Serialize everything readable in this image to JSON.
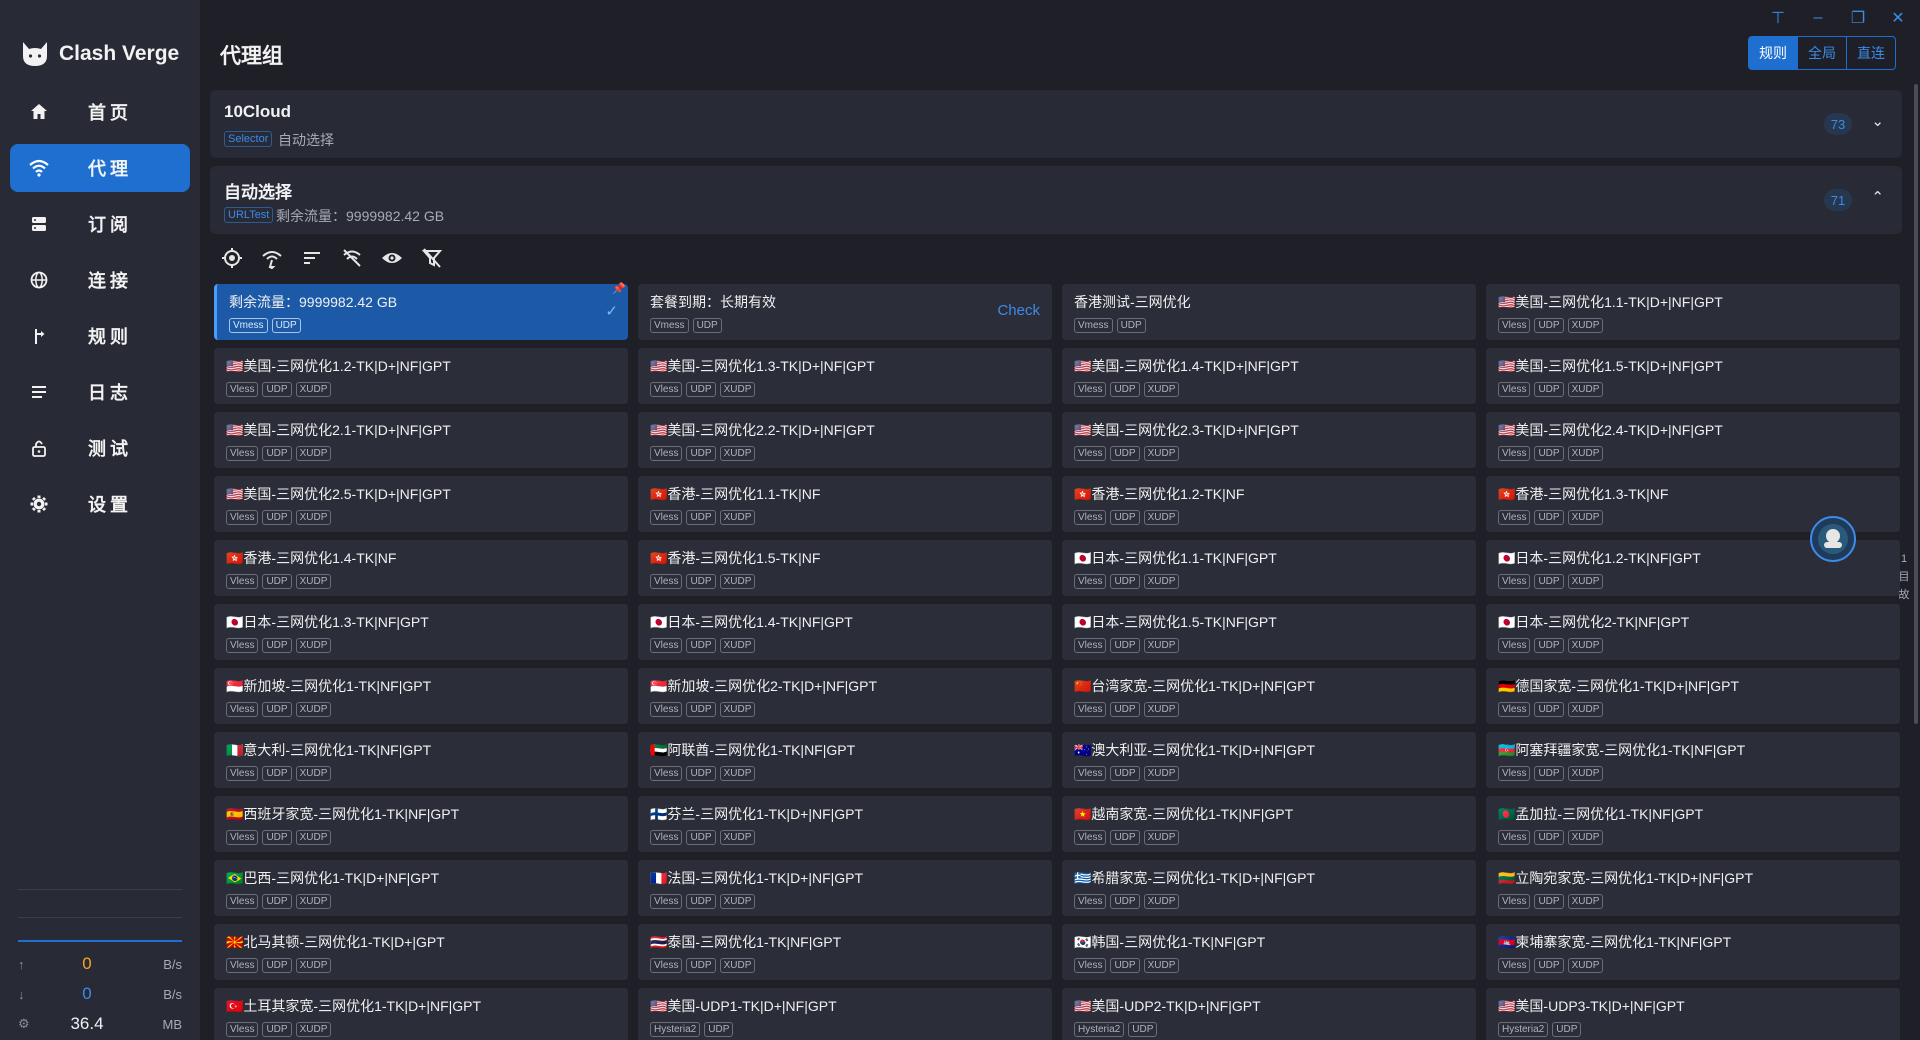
{
  "app": {
    "name": "Clash Verge"
  },
  "sidebar": {
    "items": [
      {
        "label": "首页",
        "icon": "home-icon",
        "active": false
      },
      {
        "label": "代理",
        "icon": "wifi-icon",
        "active": true
      },
      {
        "label": "订阅",
        "icon": "server-icon",
        "active": false
      },
      {
        "label": "连接",
        "icon": "globe-icon",
        "active": false
      },
      {
        "label": "规则",
        "icon": "route-icon",
        "active": false
      },
      {
        "label": "日志",
        "icon": "list-icon",
        "active": false
      },
      {
        "label": "测试",
        "icon": "lock-icon",
        "active": false
      },
      {
        "label": "设置",
        "icon": "gear-icon",
        "active": false
      }
    ],
    "traffic": {
      "up": {
        "icon": "arrow-up-icon",
        "value": "0",
        "unit": "B/s"
      },
      "down": {
        "icon": "arrow-down-icon",
        "value": "0",
        "unit": "B/s"
      },
      "memory": {
        "icon": "memory-icon",
        "value": "36.4",
        "unit": "MB"
      }
    }
  },
  "header": {
    "title": "代理组",
    "modes": [
      "规则",
      "全局",
      "直连"
    ],
    "active_mode": "规则",
    "window_controls": [
      "pin-icon",
      "minimize-icon",
      "restore-icon",
      "close-icon"
    ]
  },
  "groups": [
    {
      "name": "10Cloud",
      "type": "Selector",
      "desc": "自动选择",
      "count": "73",
      "expanded": false
    },
    {
      "name": "自动选择",
      "type": "URLTest",
      "desc": "剩余流量：9999982.42 GB",
      "count": "71",
      "expanded": true
    }
  ],
  "toolbar_icons": [
    "locate-icon",
    "delay-test-icon",
    "sort-icon",
    "url-filter-icon",
    "eye-icon",
    "filter-off-icon"
  ],
  "proxies": [
    {
      "name": "剩余流量：9999982.42 GB",
      "badges": [
        "Vmess",
        "UDP"
      ],
      "selected": true
    },
    {
      "name": "套餐到期：长期有效",
      "badges": [
        "Vmess",
        "UDP"
      ],
      "action": "Check"
    },
    {
      "name": "香港测试-三网优化",
      "badges": [
        "Vmess",
        "UDP"
      ]
    },
    {
      "name": "🇺🇸美国-三网优化1.1-TK|D+|NF|GPT",
      "badges": [
        "Vless",
        "UDP",
        "XUDP"
      ]
    },
    {
      "name": "🇺🇸美国-三网优化1.2-TK|D+|NF|GPT",
      "badges": [
        "Vless",
        "UDP",
        "XUDP"
      ]
    },
    {
      "name": "🇺🇸美国-三网优化1.3-TK|D+|NF|GPT",
      "badges": [
        "Vless",
        "UDP",
        "XUDP"
      ]
    },
    {
      "name": "🇺🇸美国-三网优化1.4-TK|D+|NF|GPT",
      "badges": [
        "Vless",
        "UDP",
        "XUDP"
      ]
    },
    {
      "name": "🇺🇸美国-三网优化1.5-TK|D+|NF|GPT",
      "badges": [
        "Vless",
        "UDP",
        "XUDP"
      ]
    },
    {
      "name": "🇺🇸美国-三网优化2.1-TK|D+|NF|GPT",
      "badges": [
        "Vless",
        "UDP",
        "XUDP"
      ]
    },
    {
      "name": "🇺🇸美国-三网优化2.2-TK|D+|NF|GPT",
      "badges": [
        "Vless",
        "UDP",
        "XUDP"
      ]
    },
    {
      "name": "🇺🇸美国-三网优化2.3-TK|D+|NF|GPT",
      "badges": [
        "Vless",
        "UDP",
        "XUDP"
      ]
    },
    {
      "name": "🇺🇸美国-三网优化2.4-TK|D+|NF|GPT",
      "badges": [
        "Vless",
        "UDP",
        "XUDP"
      ]
    },
    {
      "name": "🇺🇸美国-三网优化2.5-TK|D+|NF|GPT",
      "badges": [
        "Vless",
        "UDP",
        "XUDP"
      ]
    },
    {
      "name": "🇭🇰香港-三网优化1.1-TK|NF",
      "badges": [
        "Vless",
        "UDP",
        "XUDP"
      ]
    },
    {
      "name": "🇭🇰香港-三网优化1.2-TK|NF",
      "badges": [
        "Vless",
        "UDP",
        "XUDP"
      ]
    },
    {
      "name": "🇭🇰香港-三网优化1.3-TK|NF",
      "badges": [
        "Vless",
        "UDP",
        "XUDP"
      ]
    },
    {
      "name": "🇭🇰香港-三网优化1.4-TK|NF",
      "badges": [
        "Vless",
        "UDP",
        "XUDP"
      ]
    },
    {
      "name": "🇭🇰香港-三网优化1.5-TK|NF",
      "badges": [
        "Vless",
        "UDP",
        "XUDP"
      ]
    },
    {
      "name": "🇯🇵日本-三网优化1.1-TK|NF|GPT",
      "badges": [
        "Vless",
        "UDP",
        "XUDP"
      ]
    },
    {
      "name": "🇯🇵日本-三网优化1.2-TK|NF|GPT",
      "badges": [
        "Vless",
        "UDP",
        "XUDP"
      ]
    },
    {
      "name": "🇯🇵日本-三网优化1.3-TK|NF|GPT",
      "badges": [
        "Vless",
        "UDP",
        "XUDP"
      ]
    },
    {
      "name": "🇯🇵日本-三网优化1.4-TK|NF|GPT",
      "badges": [
        "Vless",
        "UDP",
        "XUDP"
      ]
    },
    {
      "name": "🇯🇵日本-三网优化1.5-TK|NF|GPT",
      "badges": [
        "Vless",
        "UDP",
        "XUDP"
      ]
    },
    {
      "name": "🇯🇵日本-三网优化2-TK|NF|GPT",
      "badges": [
        "Vless",
        "UDP",
        "XUDP"
      ]
    },
    {
      "name": "🇸🇬新加坡-三网优化1-TK|NF|GPT",
      "badges": [
        "Vless",
        "UDP",
        "XUDP"
      ]
    },
    {
      "name": "🇸🇬新加坡-三网优化2-TK|D+|NF|GPT",
      "badges": [
        "Vless",
        "UDP",
        "XUDP"
      ]
    },
    {
      "name": "🇨🇳台湾家宽-三网优化1-TK|D+|NF|GPT",
      "badges": [
        "Vless",
        "UDP",
        "XUDP"
      ]
    },
    {
      "name": "🇩🇪德国家宽-三网优化1-TK|D+|NF|GPT",
      "badges": [
        "Vless",
        "UDP",
        "XUDP"
      ]
    },
    {
      "name": "🇮🇹意大利-三网优化1-TK|NF|GPT",
      "badges": [
        "Vless",
        "UDP",
        "XUDP"
      ]
    },
    {
      "name": "🇦🇪阿联酋-三网优化1-TK|NF|GPT",
      "badges": [
        "Vless",
        "UDP",
        "XUDP"
      ]
    },
    {
      "name": "🇦🇺澳大利亚-三网优化1-TK|D+|NF|GPT",
      "badges": [
        "Vless",
        "UDP",
        "XUDP"
      ]
    },
    {
      "name": "🇦🇿阿塞拜疆家宽-三网优化1-TK|NF|GPT",
      "badges": [
        "Vless",
        "UDP",
        "XUDP"
      ]
    },
    {
      "name": "🇪🇸西班牙家宽-三网优化1-TK|NF|GPT",
      "badges": [
        "Vless",
        "UDP",
        "XUDP"
      ]
    },
    {
      "name": "🇫🇮芬兰-三网优化1-TK|D+|NF|GPT",
      "badges": [
        "Vless",
        "UDP",
        "XUDP"
      ]
    },
    {
      "name": "🇻🇳越南家宽-三网优化1-TK|NF|GPT",
      "badges": [
        "Vless",
        "UDP",
        "XUDP"
      ]
    },
    {
      "name": "🇧🇩孟加拉-三网优化1-TK|NF|GPT",
      "badges": [
        "Vless",
        "UDP",
        "XUDP"
      ]
    },
    {
      "name": "🇧🇷巴西-三网优化1-TK|D+|NF|GPT",
      "badges": [
        "Vless",
        "UDP",
        "XUDP"
      ]
    },
    {
      "name": "🇫🇷法国-三网优化1-TK|D+|NF|GPT",
      "badges": [
        "Vless",
        "UDP",
        "XUDP"
      ]
    },
    {
      "name": "🇬🇷希腊家宽-三网优化1-TK|D+|NF|GPT",
      "badges": [
        "Vless",
        "UDP",
        "XUDP"
      ]
    },
    {
      "name": "🇱🇹立陶宛家宽-三网优化1-TK|D+|NF|GPT",
      "badges": [
        "Vless",
        "UDP",
        "XUDP"
      ]
    },
    {
      "name": "🇲🇰北马其顿-三网优化1-TK|D+|GPT",
      "badges": [
        "Vless",
        "UDP",
        "XUDP"
      ]
    },
    {
      "name": "🇹🇭泰国-三网优化1-TK|NF|GPT",
      "badges": [
        "Vless",
        "UDP",
        "XUDP"
      ]
    },
    {
      "name": "🇰🇷韩国-三网优化1-TK|NF|GPT",
      "badges": [
        "Vless",
        "UDP",
        "XUDP"
      ]
    },
    {
      "name": "🇰🇭柬埔寨家宽-三网优化1-TK|NF|GPT",
      "badges": [
        "Vless",
        "UDP",
        "XUDP"
      ]
    },
    {
      "name": "🇹🇷土耳其家宽-三网优化1-TK|D+|NF|GPT",
      "badges": [
        "Vless",
        "UDP",
        "XUDP"
      ]
    },
    {
      "name": "🇺🇸美国-UDP1-TK|D+|NF|GPT",
      "badges": [
        "Hysteria2",
        "UDP"
      ]
    },
    {
      "name": "🇺🇸美国-UDP2-TK|D+|NF|GPT",
      "badges": [
        "Hysteria2",
        "UDP"
      ]
    },
    {
      "name": "🇺🇸美国-UDP3-TK|D+|NF|GPT",
      "badges": [
        "Hysteria2",
        "UDP"
      ]
    }
  ],
  "side_text": [
    "1",
    "目",
    "故"
  ],
  "colors": {
    "accent": "#1e6fd0",
    "background": "#1e1f27",
    "sidebar": "#282a36",
    "card": "#2b2d39"
  }
}
